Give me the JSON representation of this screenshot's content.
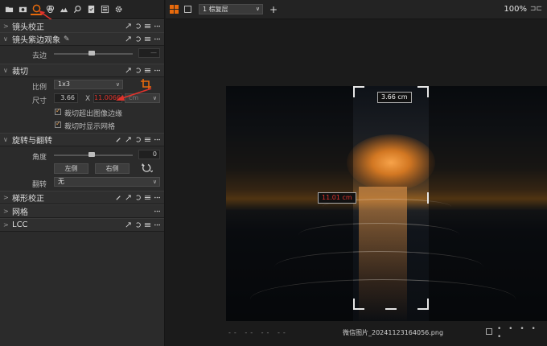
{
  "toolbar": {
    "icons": [
      "folder-icon",
      "camera-icon",
      "lens-icon",
      "color-icon",
      "exposure-icon",
      "search-icon",
      "metadata-icon",
      "output-icon",
      "settings-icon"
    ]
  },
  "sections": {
    "lens_correction": "镜头校正",
    "lens_purple_fringe": "镜头紫边观象",
    "purple_edge_label": "去边",
    "purple_edge_value": "—",
    "crop": "裁切",
    "ratio_label": "比例",
    "ratio_value": "1x3",
    "size_label": "尺寸",
    "size_w": "3.66",
    "size_x": "X",
    "size_h": "11.0066",
    "unit": "cm",
    "check_crop_outside": "裁切超出图像边缘",
    "check_show_grid": "裁切时显示网格",
    "rotate_flip": "旋转与翻转",
    "angle_label": "角度",
    "angle_value": "0",
    "left_btn": "左侧",
    "right_btn": "右侧",
    "flip_label": "翻转",
    "flip_value": "无",
    "keystone": "梯形校正",
    "grid": "网格",
    "lcc": "LCC"
  },
  "topbar": {
    "layout_select": "1 棕复层",
    "zoom": "100%",
    "fit_icon": "fit-icon"
  },
  "canvas": {
    "width_badge": "3.66 cm",
    "height_badge": "11.01 cm"
  },
  "status": {
    "dashes": "-- -- -- --",
    "filename": "微信图片_20241123164056.png",
    "dots": "• • • • •"
  },
  "colors": {
    "accent": "#e86a0c",
    "red": "#e0332c"
  }
}
